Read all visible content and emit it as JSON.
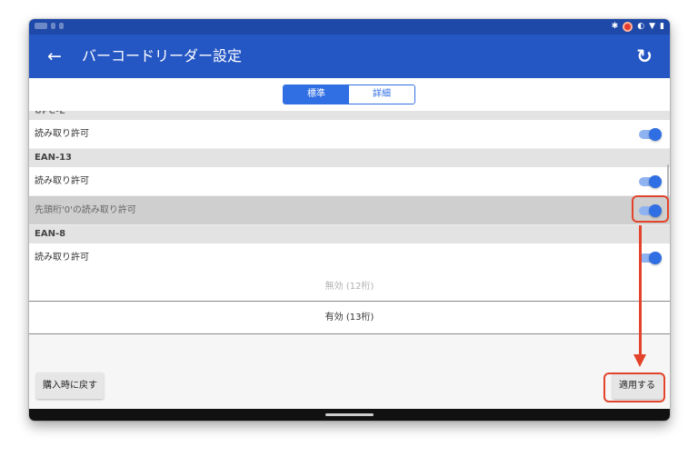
{
  "status": {
    "icons": [
      "bluetooth-icon",
      "record-icon",
      "rotate-icon",
      "wifi-icon",
      "battery-icon"
    ]
  },
  "appbar": {
    "title": "バーコードリーダー設定",
    "back_icon": "arrow-left-icon",
    "refresh_icon": "refresh-icon"
  },
  "tabs": {
    "standard": "標準",
    "detail": "詳細",
    "selected": "標準"
  },
  "sections": [
    {
      "header": "UPC-E",
      "rows": [
        {
          "label": "読み取り許可",
          "enabled": true
        }
      ]
    },
    {
      "header": "EAN-13",
      "rows": [
        {
          "label": "読み取り許可",
          "enabled": true
        },
        {
          "label": "先頭桁'0'の読み取り許可",
          "enabled": true
        }
      ]
    },
    {
      "header": "EAN-8",
      "rows": [
        {
          "label": "読み取り許可",
          "enabled": true
        }
      ]
    }
  ],
  "options": {
    "disabled_option": "無効 (12桁)",
    "selected_option": "有効 (13桁)"
  },
  "footer": {
    "reset_label": "購入時に戻す",
    "apply_label": "適用する"
  },
  "colors": {
    "appbar": "#2456c4",
    "accent": "#2f6ee3",
    "highlight": "#e2432a"
  }
}
